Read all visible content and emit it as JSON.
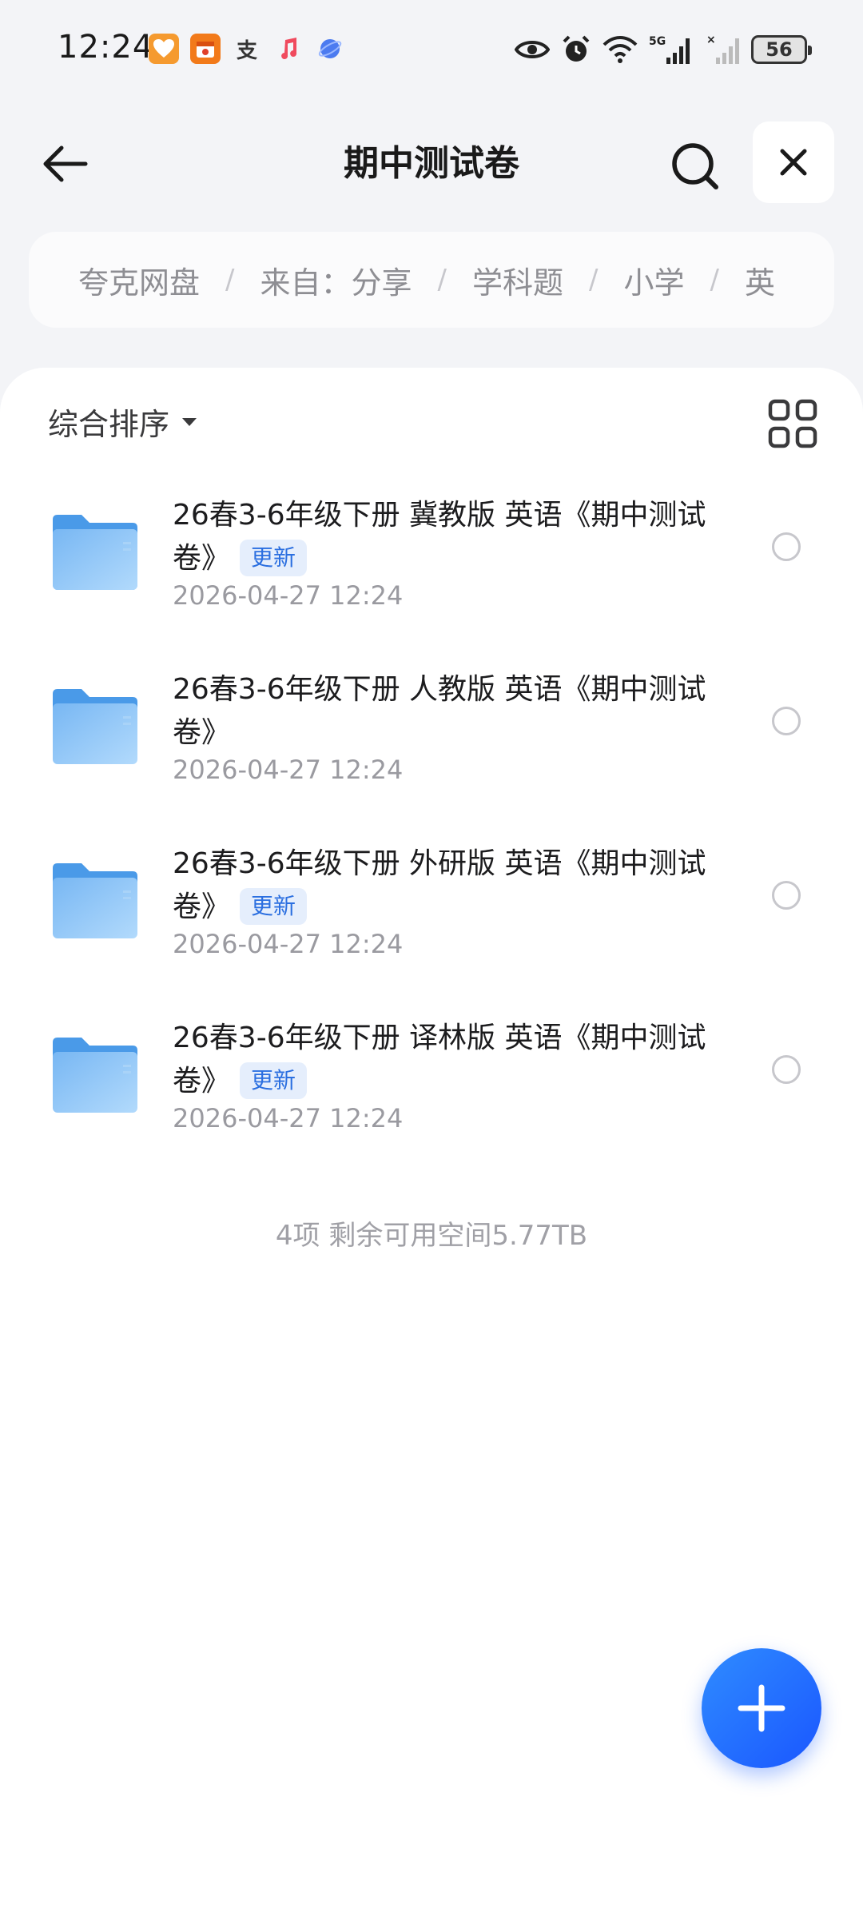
{
  "status_bar": {
    "time": "12:24",
    "battery": "56",
    "app_icons": [
      "health-icon",
      "calendar-icon",
      "alipay-icon",
      "music-icon",
      "browser-icon"
    ],
    "status_icons": [
      "eye-icon",
      "alarm-icon",
      "wifi-icon",
      "signal-5g-icon",
      "signal-icon"
    ]
  },
  "header": {
    "title": "期中测试卷"
  },
  "breadcrumb": [
    "夸克网盘",
    "来自：分享",
    "学科题",
    "小学",
    "英"
  ],
  "toolbar": {
    "sort_label": "综合排序"
  },
  "files": [
    {
      "title": "26春3-6年级下册 冀教版 英语《期中测试卷》",
      "badge": "更新",
      "date": "2026-04-27 12:24"
    },
    {
      "title": "26春3-6年级下册 人教版 英语《期中测试卷》",
      "badge": "",
      "date": "2026-04-27 12:24"
    },
    {
      "title": "26春3-6年级下册 外研版 英语《期中测试卷》",
      "badge": "更新",
      "date": "2026-04-27 12:24"
    },
    {
      "title": "26春3-6年级下册 译林版 英语《期中测试卷》",
      "badge": "更新",
      "date": "2026-04-27 12:24"
    }
  ],
  "footer": {
    "summary": "4项 剩余可用空间5.77TB"
  },
  "colors": {
    "accent": "#2b6fe0",
    "fab": "#1a56ff",
    "folder": "#6fb3f2"
  }
}
